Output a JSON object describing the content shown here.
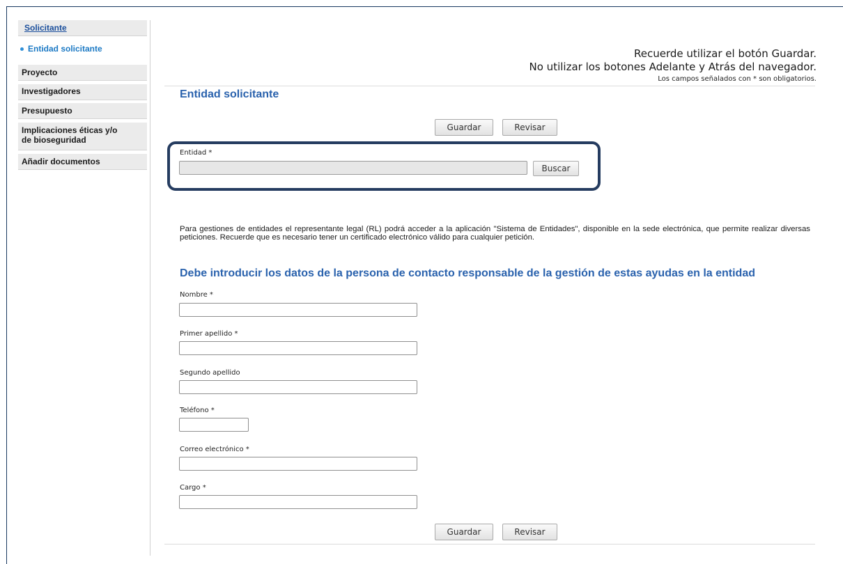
{
  "sidebar": {
    "link": "Solicitante",
    "active_item": "Entidad solicitante",
    "items": [
      {
        "label": "Proyecto"
      },
      {
        "label": "Investigadores"
      },
      {
        "label": "Presupuesto"
      },
      {
        "label": "Implicaciones éticas y/o de bioseguridad"
      },
      {
        "label": "Añadir documentos"
      }
    ]
  },
  "notice": {
    "line1": "Recuerde utilizar el botón Guardar.",
    "line2": "No utilizar los botones Adelante y Atrás del navegador.",
    "line3": "Los campos señalados con * son obligatorios."
  },
  "section_title": "Entidad solicitante",
  "buttons": {
    "save": "Guardar",
    "review": "Revisar",
    "search": "Buscar"
  },
  "entidad": {
    "label": "Entidad *",
    "value": ""
  },
  "info_text": "Para gestiones de entidades el representante legal (RL) podrá acceder a la aplicación \"Sistema de Entidades\", disponible en la sede electrónica, que permite realizar diversas peticiones. Recuerde que es necesario tener un certificado electrónico válido para cualquier petición.",
  "contact_title": "Debe introducir los datos de la persona de contacto responsable de la gestión de estas ayudas en la entidad",
  "form": {
    "nombre": {
      "label": "Nombre  *",
      "value": ""
    },
    "primer_apellido": {
      "label": "Primer apellido  *",
      "value": ""
    },
    "segundo_apellido": {
      "label": "Segundo apellido",
      "value": ""
    },
    "telefono": {
      "label": "Teléfono  *",
      "value": ""
    },
    "correo": {
      "label": "Correo electrónico  *",
      "value": ""
    },
    "cargo": {
      "label": "Cargo  *",
      "value": ""
    }
  },
  "colors": {
    "accent": "#2a62ad",
    "highlight_border": "#253c60",
    "sidebar_bg": "#ebebeb"
  }
}
